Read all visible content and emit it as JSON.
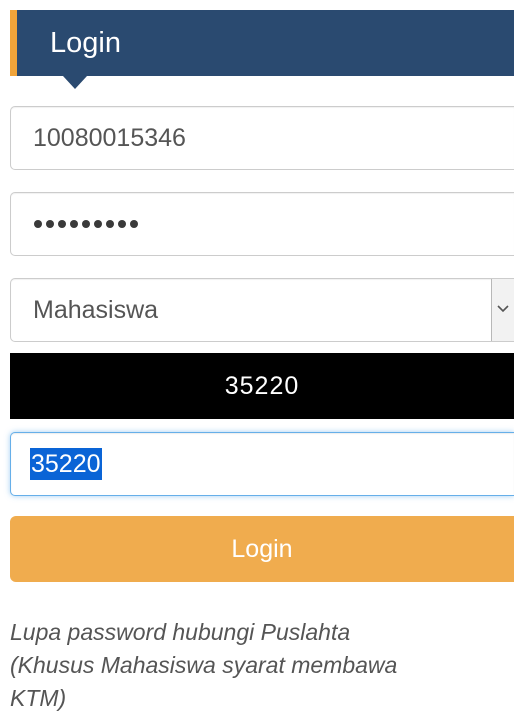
{
  "header": {
    "title": "Login",
    "colors": {
      "background": "#2a4a70",
      "accent": "#f0a43a"
    }
  },
  "form": {
    "username": {
      "value": "10080015346"
    },
    "password": {
      "masked_length": 9
    },
    "role_select": {
      "selected": "Mahasiswa",
      "arrow_icon": "chevron-down-icon"
    },
    "captcha": {
      "image_text": "35220",
      "input_value": "35220"
    },
    "login_button": {
      "label": "Login",
      "color": "#f0ac4e"
    }
  },
  "note": {
    "lines": [
      "Lupa password hubungi Puslahta",
      "(Khusus Mahasiswa syarat membawa",
      "KTM)"
    ]
  }
}
